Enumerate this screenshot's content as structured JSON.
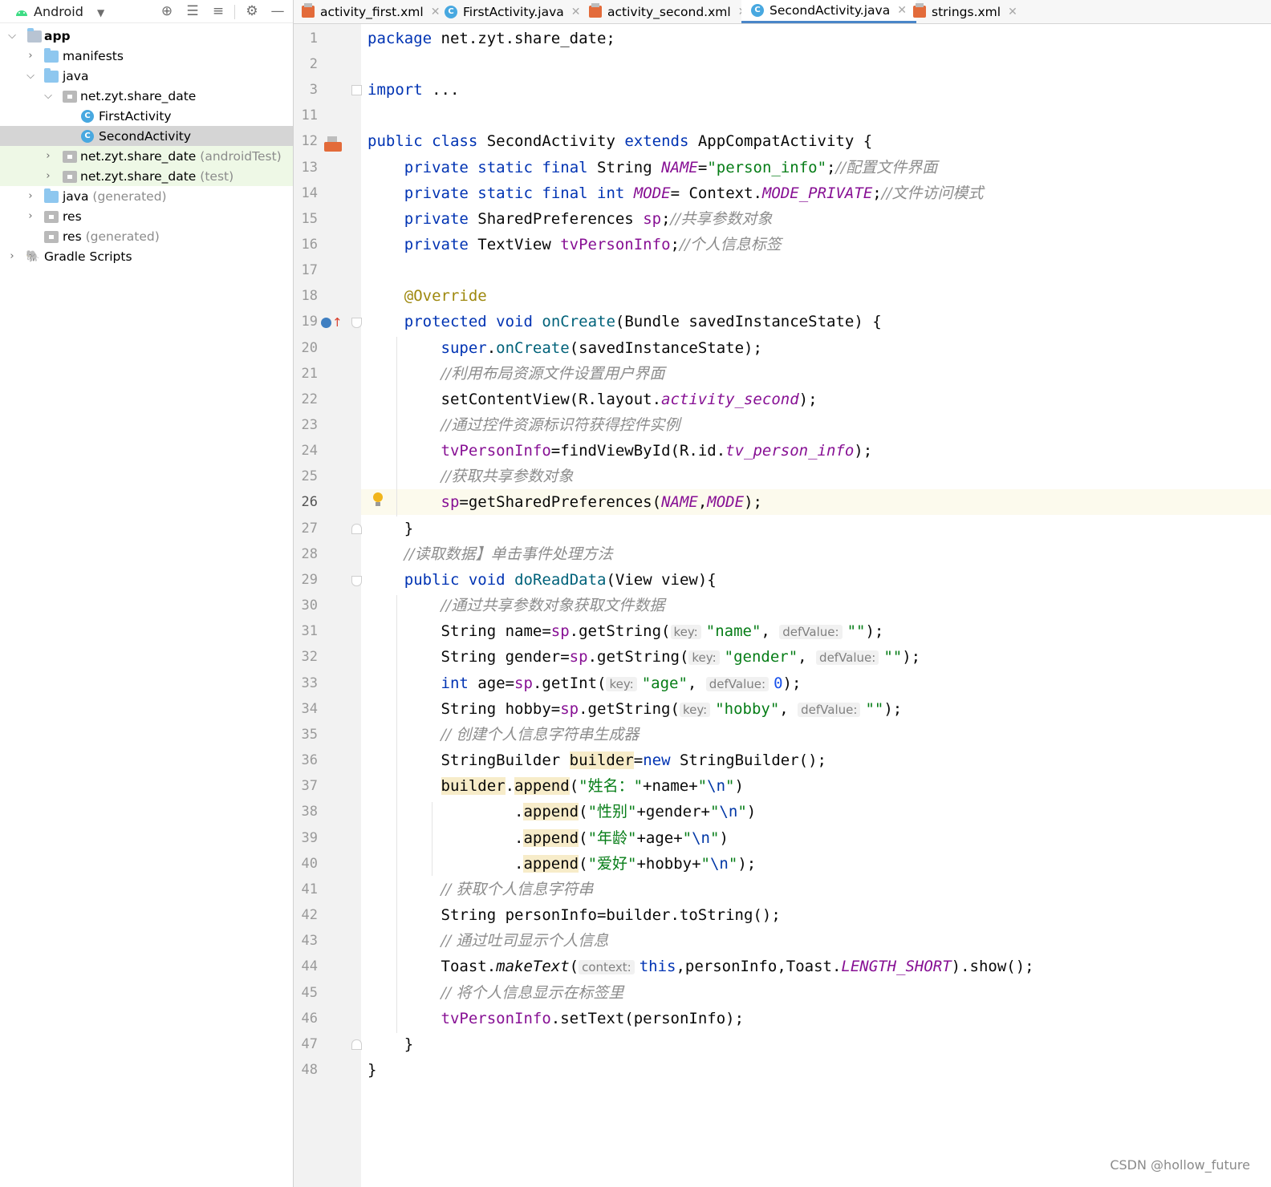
{
  "project_panel": {
    "view_name": "Android",
    "tree": [
      {
        "label": "app",
        "secondary": "",
        "type": "module",
        "expanded": true
      },
      {
        "label": "manifests",
        "secondary": "",
        "type": "folder",
        "expanded": false
      },
      {
        "label": "java",
        "secondary": "",
        "type": "folder",
        "expanded": true
      },
      {
        "label": "net.zyt.share_date",
        "secondary": "",
        "type": "package",
        "expanded": true
      },
      {
        "label": "FirstActivity",
        "secondary": "",
        "type": "class"
      },
      {
        "label": "SecondActivity",
        "secondary": "",
        "type": "class",
        "selected": true
      },
      {
        "label": "net.zyt.share_date",
        "secondary": "(androidTest)",
        "type": "package",
        "expanded": false
      },
      {
        "label": "net.zyt.share_date",
        "secondary": "(test)",
        "type": "package",
        "expanded": false
      },
      {
        "label": "java",
        "secondary": "(generated)",
        "type": "folder",
        "expanded": false
      },
      {
        "label": "res",
        "secondary": "",
        "type": "folder",
        "expanded": false
      },
      {
        "label": "res",
        "secondary": "(generated)",
        "type": "folder"
      },
      {
        "label": "Gradle Scripts",
        "secondary": "",
        "type": "gradle",
        "expanded": false
      }
    ]
  },
  "editor_tabs": [
    {
      "label": "activity_first.xml",
      "icon": "xml-file-icon"
    },
    {
      "label": "FirstActivity.java",
      "icon": "java-class-icon"
    },
    {
      "label": "activity_second.xml",
      "icon": "xml-file-icon"
    },
    {
      "label": "SecondActivity.java",
      "icon": "java-class-icon",
      "active": true
    },
    {
      "label": "strings.xml",
      "icon": "xml-file-icon"
    }
  ],
  "code": {
    "current_line": "26",
    "lines": [
      {
        "n": "1",
        "t": "package net.zyt.share_date;"
      },
      {
        "n": "2",
        "t": ""
      },
      {
        "n": "3",
        "t": "import ..."
      },
      {
        "n": "11",
        "t": ""
      },
      {
        "n": "12",
        "t": "public class SecondActivity extends AppCompatActivity {"
      },
      {
        "n": "13",
        "t": "    private static final String NAME=\"person_info\";//配置文件界面"
      },
      {
        "n": "14",
        "t": "    private static final int MODE= Context.MODE_PRIVATE;//文件访问模式"
      },
      {
        "n": "15",
        "t": "    private SharedPreferences sp;//共享参数对象"
      },
      {
        "n": "16",
        "t": "    private TextView tvPersonInfo;//个人信息标签"
      },
      {
        "n": "17",
        "t": ""
      },
      {
        "n": "18",
        "t": "    @Override"
      },
      {
        "n": "19",
        "t": "    protected void onCreate(Bundle savedInstanceState) {"
      },
      {
        "n": "20",
        "t": "        super.onCreate(savedInstanceState);"
      },
      {
        "n": "21",
        "t": "        //利用布局资源文件设置用户界面"
      },
      {
        "n": "22",
        "t": "        setContentView(R.layout.activity_second);"
      },
      {
        "n": "23",
        "t": "        //通过控件资源标识符获得控件实例"
      },
      {
        "n": "24",
        "t": "        tvPersonInfo=findViewById(R.id.tv_person_info);"
      },
      {
        "n": "25",
        "t": "        //获取共享参数对象"
      },
      {
        "n": "26",
        "t": "        sp=getSharedPreferences(NAME,MODE);"
      },
      {
        "n": "27",
        "t": "    }"
      },
      {
        "n": "28",
        "t": "    //读取数据】单击事件处理方法"
      },
      {
        "n": "29",
        "t": "    public void doReadData(View view){"
      },
      {
        "n": "30",
        "t": "        //通过共享参数对象获取文件数据"
      },
      {
        "n": "31",
        "t": "        String name=sp.getString(key: \"name\", defValue: \"\");"
      },
      {
        "n": "32",
        "t": "        String gender=sp.getString(key: \"gender\", defValue: \"\");"
      },
      {
        "n": "33",
        "t": "        int age=sp.getInt(key: \"age\", defValue: 0);"
      },
      {
        "n": "34",
        "t": "        String hobby=sp.getString(key: \"hobby\", defValue: \"\");"
      },
      {
        "n": "35",
        "t": "        // 创建个人信息字符串生成器"
      },
      {
        "n": "36",
        "t": "        StringBuilder builder=new StringBuilder();"
      },
      {
        "n": "37",
        "t": "        builder.append(\"姓名：\"+name+\"\\n\")"
      },
      {
        "n": "38",
        "t": "                .append(\"性别\"+gender+\"\\n\")"
      },
      {
        "n": "39",
        "t": "                .append(\"年龄\"+age+\"\\n\")"
      },
      {
        "n": "40",
        "t": "                .append(\"爱好\"+hobby+\"\\n\");"
      },
      {
        "n": "41",
        "t": "        // 获取个人信息字符串"
      },
      {
        "n": "42",
        "t": "        String personInfo=builder.toString();"
      },
      {
        "n": "43",
        "t": "        // 通过吐司显示个人信息"
      },
      {
        "n": "44",
        "t": "        Toast.makeText(context: this,personInfo,Toast.LENGTH_SHORT).show();"
      },
      {
        "n": "45",
        "t": "        // 将个人信息显示在标签里"
      },
      {
        "n": "46",
        "t": "        tvPersonInfo.setText(personInfo);"
      },
      {
        "n": "47",
        "t": "    }"
      },
      {
        "n": "48",
        "t": "}"
      }
    ]
  },
  "watermark": "CSDN @hollow_future"
}
